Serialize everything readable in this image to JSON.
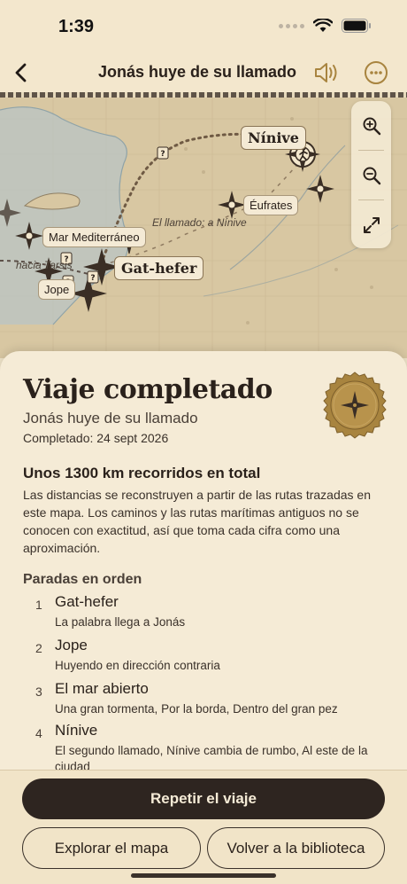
{
  "status_bar": {
    "time": "1:39"
  },
  "nav": {
    "title": "Jonás huye de su llamado"
  },
  "map": {
    "labels": {
      "ninive": "Nínive",
      "eufrates": "Éufrates",
      "mar_mediterraneo": "Mar Mediterráneo",
      "gat_hefer": "Gat-hefer",
      "jope": "Jope",
      "llamado_route": "El llamado: a Nínive",
      "hacia_tarsis": "hacia Tarsis",
      "unknown_marker": "?"
    }
  },
  "summary": {
    "title": "Viaje completado",
    "subtitle": "Jonás huye de su llamado",
    "completed": "Completado: 24 sept 2026",
    "distance_title": "Unos 1300 km recorridos en total",
    "distance_body": "Las distancias se reconstruyen a partir de las rutas trazadas en este mapa. Los caminos y las rutas marítimas antiguos no se conocen con exactitud, así que toma cada cifra como una aproximación.",
    "stops_title": "Paradas en orden",
    "stops": [
      {
        "num": "1",
        "name": "Gat-hefer",
        "desc": "La palabra llega a Jonás"
      },
      {
        "num": "2",
        "name": "Jope",
        "desc": "Huyendo en dirección contraria"
      },
      {
        "num": "3",
        "name": "El mar abierto",
        "desc": "Una gran tormenta, Por la borda, Dentro del gran pez"
      },
      {
        "num": "4",
        "name": "Nínive",
        "desc": "El segundo llamado, Nínive cambia de rumbo, Al este de la ciudad"
      }
    ]
  },
  "actions": {
    "replay": "Repetir el viaje",
    "explore": "Explorar el mapa",
    "library": "Volver a la biblioteca"
  },
  "colors": {
    "parchment": "#f5ebd6",
    "ink": "#2e2520",
    "badge_gold": "#a8843f"
  }
}
